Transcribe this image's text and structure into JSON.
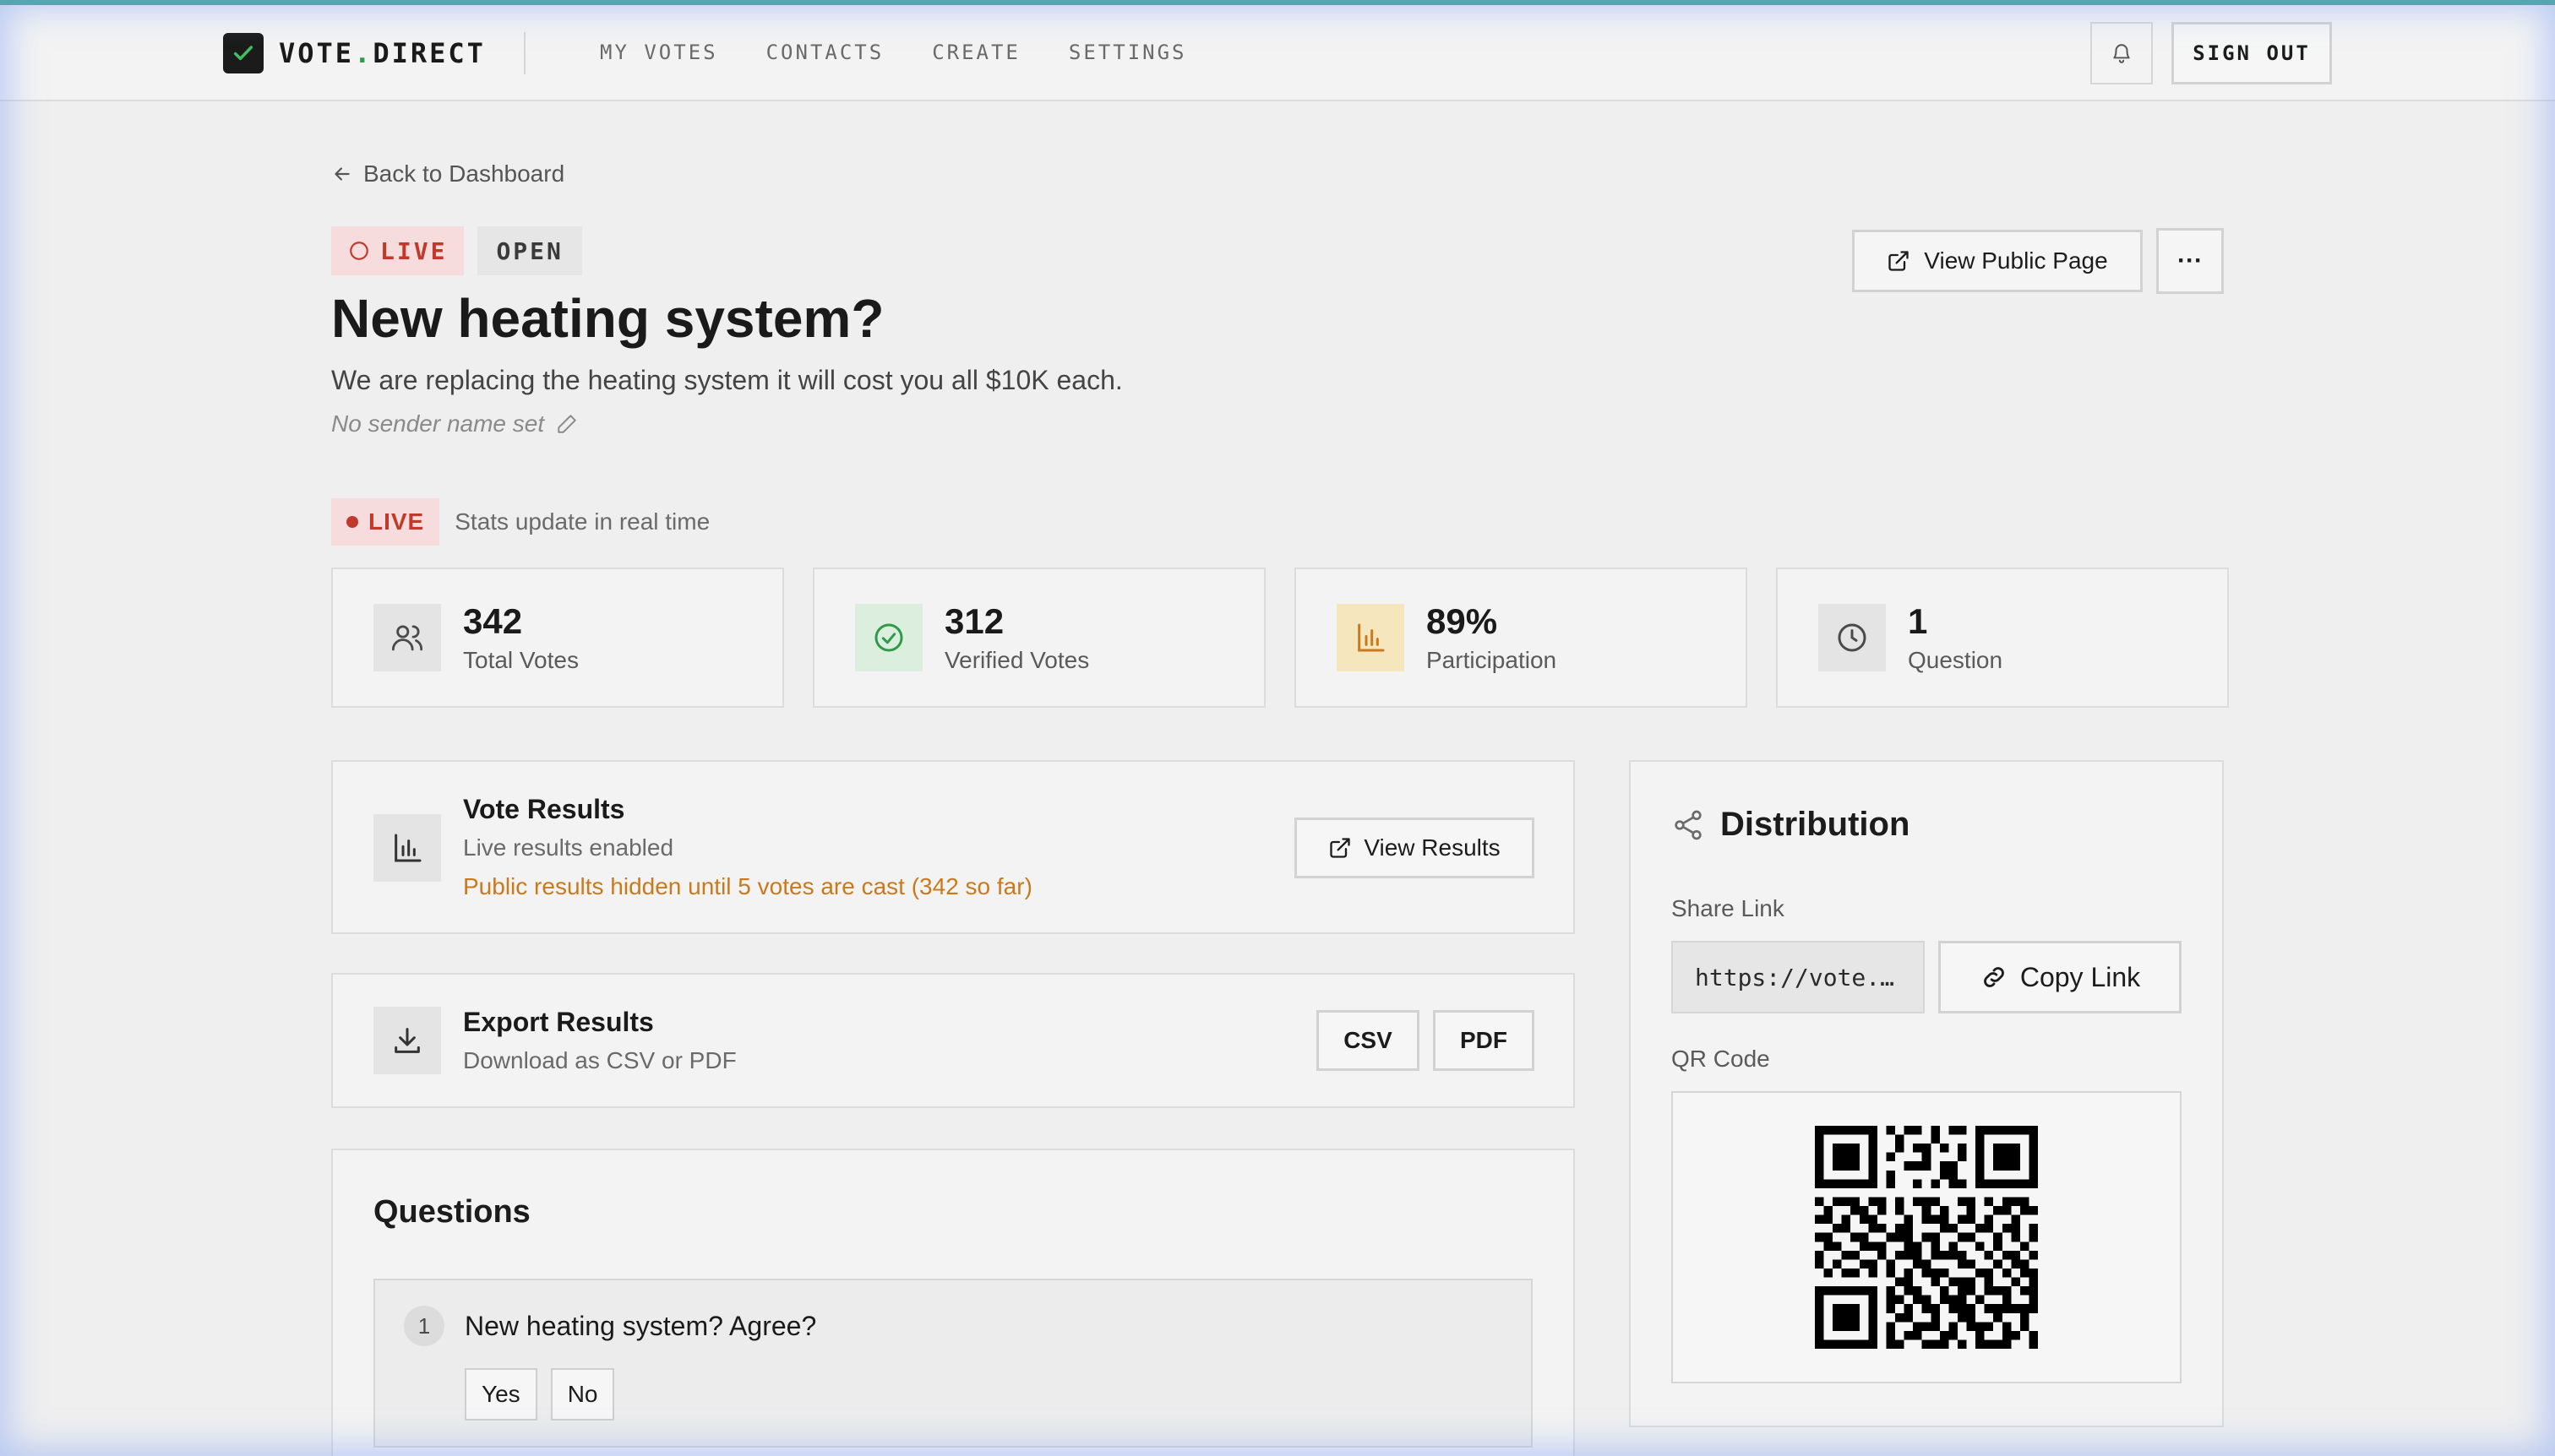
{
  "nav": {
    "brand_main": "VOTE",
    "brand_dot": ".",
    "brand_tail": "DIRECT",
    "links": [
      "MY VOTES",
      "CONTACTS",
      "CREATE",
      "SETTINGS"
    ],
    "sign_out": "SIGN OUT",
    "bell_icon": "bell-icon"
  },
  "header": {
    "back_label": "Back to Dashboard",
    "badge_live": "LIVE",
    "badge_open": "OPEN",
    "title": "New heating system?",
    "description": "We are replacing the heating system it will cost you all $10K each.",
    "sender": "No sender name set",
    "view_public": "View Public Page",
    "more": "···"
  },
  "live": {
    "pill": "LIVE",
    "note": "Stats update in real time"
  },
  "stats": [
    {
      "value": "342",
      "label": "Total Votes",
      "icon": "users-icon"
    },
    {
      "value": "312",
      "label": "Verified Votes",
      "icon": "check-circle-icon"
    },
    {
      "value": "89%",
      "label": "Participation",
      "icon": "bar-chart-icon"
    },
    {
      "value": "1",
      "label": "Question",
      "icon": "clock-icon"
    }
  ],
  "results": {
    "title": "Vote Results",
    "sub": "Live results enabled",
    "warning": "Public results hidden until 5 votes are cast (342 so far)",
    "button": "View Results"
  },
  "export": {
    "title": "Export Results",
    "sub": "Download as CSV or PDF",
    "csv": "CSV",
    "pdf": "PDF"
  },
  "questions": {
    "heading": "Questions",
    "items": [
      {
        "num": "1",
        "text": "New heating system? Agree?",
        "options": [
          "Yes",
          "No"
        ]
      }
    ]
  },
  "distribution": {
    "heading": "Distribution",
    "share_label": "Share Link",
    "share_value": "https://vote.…",
    "copy_button": "Copy Link",
    "qr_label": "QR Code"
  },
  "colors": {
    "accent_green": "#2e9a4a",
    "live_red": "#c0392b",
    "warning_amber": "#c97a1c"
  }
}
